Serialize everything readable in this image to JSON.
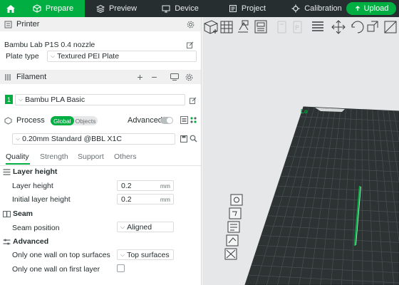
{
  "topbar": {
    "tabs": [
      {
        "label": "Prepare",
        "icon": "cube-icon",
        "active": true
      },
      {
        "label": "Preview",
        "icon": "layers-icon",
        "active": false
      },
      {
        "label": "Device",
        "icon": "device-icon",
        "active": false
      },
      {
        "label": "Project",
        "icon": "project-icon",
        "active": false
      },
      {
        "label": "Calibration",
        "icon": "calibration-icon",
        "active": false
      }
    ],
    "upload_label": "Upload",
    "accent": "#00ae42",
    "bar_color": "#262e30"
  },
  "printer": {
    "title": "Printer",
    "model": "Bambu Lab P1S 0.4 nozzle",
    "plate_type_label": "Plate type",
    "plate_type_value": "Textured PEI Plate"
  },
  "filament": {
    "title": "Filament",
    "slot_number": "1",
    "value": "Bambu PLA Basic",
    "slot_color": "#00ae42"
  },
  "process": {
    "title": "Process",
    "mode_global": "Global",
    "mode_objects": "Objects",
    "advanced_label": "Advanced",
    "preset": "0.20mm Standard @BBL X1C",
    "subtabs": [
      "Quality",
      "Strength",
      "Support",
      "Others"
    ],
    "active_subtab": "Quality",
    "groups": {
      "layer_height": {
        "title": "Layer height",
        "layer_height_label": "Layer height",
        "layer_height_value": "0.2",
        "initial_label": "Initial layer height",
        "initial_value": "0.2",
        "unit": "mm"
      },
      "seam": {
        "title": "Seam",
        "position_label": "Seam position",
        "position_value": "Aligned"
      },
      "advanced": {
        "title": "Advanced",
        "top_wall_label": "Only one wall on top surfaces",
        "top_wall_value": "Top surfaces",
        "first_wall_label": "Only one wall on first layer"
      }
    }
  },
  "viewport": {
    "plate_label": "Lo",
    "bed_color": "#2d3233",
    "grid_color": "#4a5152",
    "model_color": "#00ae42"
  }
}
